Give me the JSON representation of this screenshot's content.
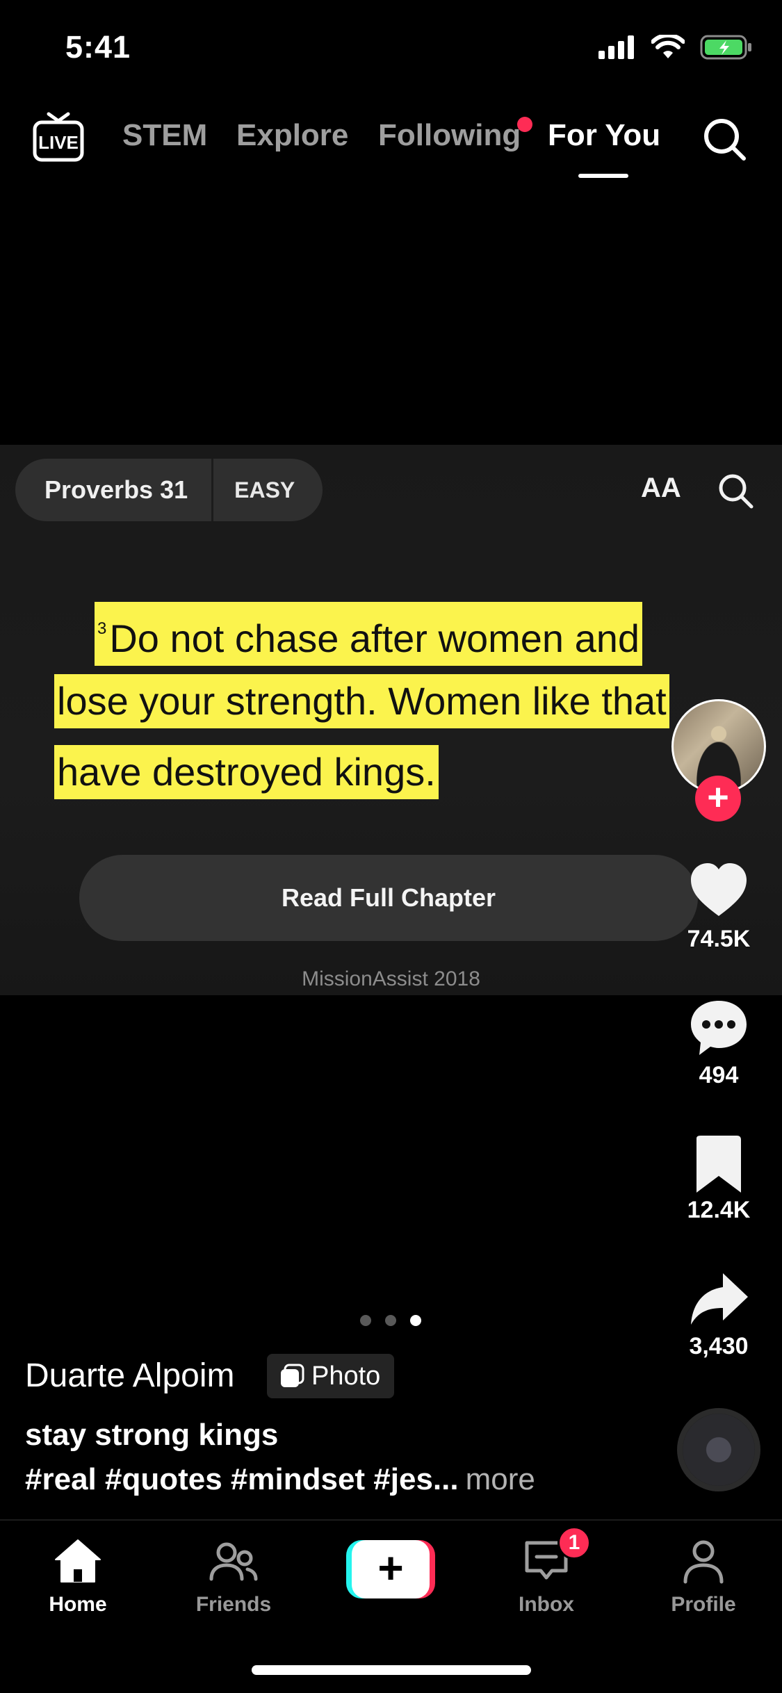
{
  "status_bar": {
    "time": "5:41",
    "icons": [
      "cellular-signal-icon",
      "wifi-icon",
      "battery-charging-icon"
    ]
  },
  "top_nav": {
    "live_icon": "live-icon",
    "tabs": [
      {
        "label": "STEM",
        "active": false
      },
      {
        "label": "Explore",
        "active": false
      },
      {
        "label": "Following",
        "active": false,
        "has_dot": true
      },
      {
        "label": "For You",
        "active": true
      }
    ],
    "search_icon": "search-icon"
  },
  "video": {
    "book": "Proverbs 31",
    "level": "EASY",
    "text_size_label": "AA",
    "verse_number": "3",
    "verse_lines": [
      "Do not chase after women and",
      "lose your strength. Women like that",
      "have destroyed kings."
    ],
    "read_button": "Read Full Chapter",
    "copyright": "MissionAssist 2018"
  },
  "sidebar": {
    "likes": "74.5K",
    "comments": "494",
    "saves": "12.4K",
    "shares": "3,430"
  },
  "carousel": {
    "count": 3,
    "active_index": 2
  },
  "caption": {
    "username": "Duarte Alpoim",
    "badge": "Photo",
    "title": "stay strong kings",
    "hashtags": "#real #quotes #mindset #jes...",
    "more": "more"
  },
  "tab_bar": {
    "home": "Home",
    "friends": "Friends",
    "inbox": "Inbox",
    "inbox_badge": "1",
    "profile": "Profile",
    "create": "+"
  },
  "colors": {
    "accent_red": "#fe2c55",
    "accent_cyan": "#25f4ee",
    "highlight_yellow": "#fbf34d"
  }
}
